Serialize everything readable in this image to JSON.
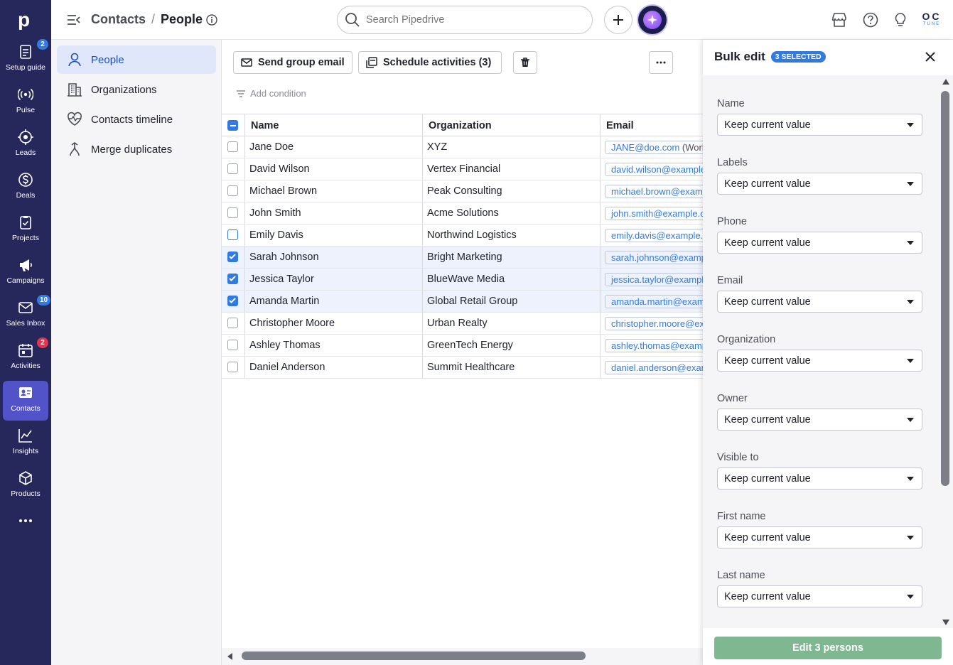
{
  "rail": {
    "items": [
      {
        "label": "Setup guide",
        "icon": "setup-guide-icon",
        "badge": "2",
        "badge_color": "blue"
      },
      {
        "label": "Pulse",
        "icon": "pulse-icon"
      },
      {
        "label": "Leads",
        "icon": "leads-icon"
      },
      {
        "label": "Deals",
        "icon": "deals-icon"
      },
      {
        "label": "Projects",
        "icon": "projects-icon"
      },
      {
        "label": "Campaigns",
        "icon": "campaigns-icon"
      },
      {
        "label": "Sales Inbox",
        "icon": "sales-inbox-icon",
        "badge": "10",
        "badge_color": "blue"
      },
      {
        "label": "Activities",
        "icon": "activities-icon",
        "badge": "2",
        "badge_color": "red"
      },
      {
        "label": "Contacts",
        "icon": "contacts-icon",
        "active": true
      },
      {
        "label": "Insights",
        "icon": "insights-icon"
      },
      {
        "label": "Products",
        "icon": "products-icon"
      }
    ]
  },
  "header": {
    "breadcrumb_root": "Contacts",
    "breadcrumb_sep": "/",
    "breadcrumb_current": "People",
    "search_placeholder": "Search Pipedrive",
    "avatar_initials": "OC",
    "avatar_sub": "TUNE"
  },
  "sidebar": {
    "items": [
      {
        "label": "People",
        "icon": "person-icon",
        "active": true
      },
      {
        "label": "Organizations",
        "icon": "building-icon"
      },
      {
        "label": "Contacts timeline",
        "icon": "heartbeat-icon"
      },
      {
        "label": "Merge duplicates",
        "icon": "merge-icon"
      }
    ]
  },
  "toolbar": {
    "send_group_email": "Send group email",
    "schedule_activities": "Schedule activities (3)",
    "add_condition": "Add condition"
  },
  "table": {
    "columns": [
      "Name",
      "Organization",
      "Email"
    ],
    "rows": [
      {
        "name": "Jane Doe",
        "org": "XYZ",
        "email": "JANE@doe.com",
        "email_suffix": "(Work",
        "checked": false
      },
      {
        "name": "David Wilson",
        "org": "Vertex Financial",
        "email": "david.wilson@example",
        "checked": false
      },
      {
        "name": "Michael Brown",
        "org": "Peak Consulting",
        "email": "michael.brown@examp",
        "checked": false
      },
      {
        "name": "John Smith",
        "org": "Acme Solutions",
        "email": "john.smith@example.c",
        "checked": false
      },
      {
        "name": "Emily Davis",
        "org": "Northwind Logistics",
        "email": "emily.davis@example.c",
        "checked": false,
        "focus": true
      },
      {
        "name": "Sarah Johnson",
        "org": "Bright Marketing",
        "email": "sarah.johnson@examp",
        "checked": true
      },
      {
        "name": "Jessica Taylor",
        "org": "BlueWave Media",
        "email": "jessica.taylor@example",
        "checked": true
      },
      {
        "name": "Amanda Martin",
        "org": "Global Retail Group",
        "email": "amanda.martin@examp",
        "checked": true
      },
      {
        "name": "Christopher Moore",
        "org": "Urban Realty",
        "email": "christopher.moore@ex",
        "checked": false
      },
      {
        "name": "Ashley Thomas",
        "org": "GreenTech Energy",
        "email": "ashley.thomas@examp",
        "checked": false
      },
      {
        "name": "Daniel Anderson",
        "org": "Summit Healthcare",
        "email": "daniel.anderson@exam",
        "checked": false
      }
    ]
  },
  "bulk_edit": {
    "title": "Bulk edit",
    "selected_badge": "3 SELECTED",
    "fields": [
      {
        "label": "Name",
        "value": "Keep current value"
      },
      {
        "label": "Labels",
        "value": "Keep current value"
      },
      {
        "label": "Phone",
        "value": "Keep current value"
      },
      {
        "label": "Email",
        "value": "Keep current value"
      },
      {
        "label": "Organization",
        "value": "Keep current value"
      },
      {
        "label": "Owner",
        "value": "Keep current value"
      },
      {
        "label": "Visible to",
        "value": "Keep current value"
      },
      {
        "label": "First name",
        "value": "Keep current value"
      },
      {
        "label": "Last name",
        "value": "Keep current value"
      }
    ],
    "submit_label": "Edit 3 persons"
  },
  "colors": {
    "rail_bg": "#26275b",
    "active_rail": "#5353c9",
    "accent_blue": "#317ae2",
    "submit_green": "#7fb890"
  }
}
